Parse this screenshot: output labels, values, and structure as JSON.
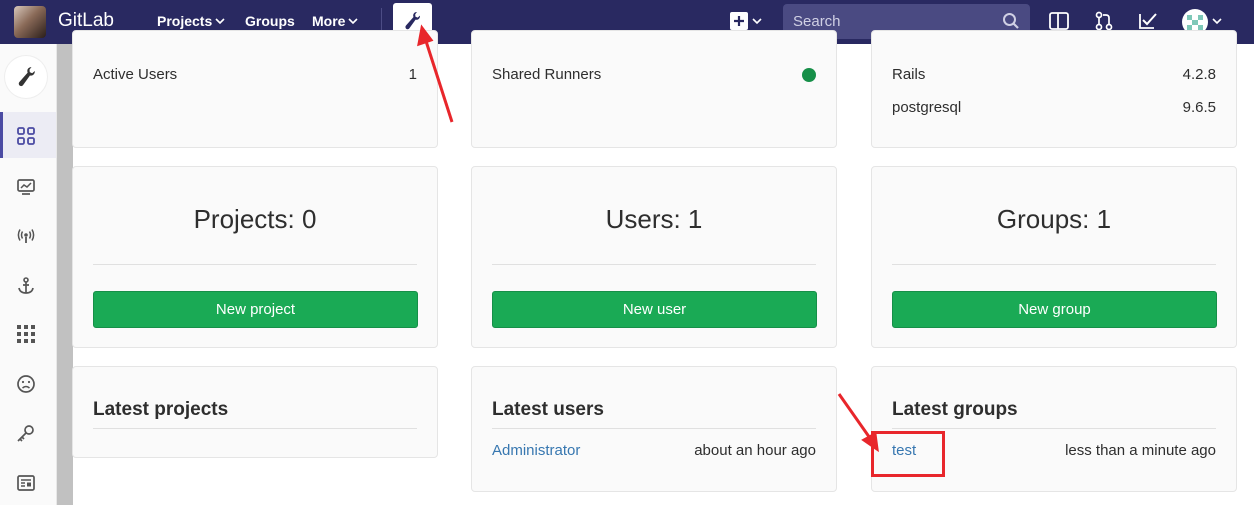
{
  "navbar": {
    "brand": "GitLab",
    "projects_label": "Projects",
    "groups_label": "Groups",
    "more_label": "More",
    "search_placeholder": "Search"
  },
  "sidebar": {
    "items": [
      {
        "icon": "overview-grid-icon"
      },
      {
        "icon": "monitoring-icon"
      },
      {
        "icon": "messages-broadcast-icon"
      },
      {
        "icon": "system-hooks-icon"
      },
      {
        "icon": "applications-icon"
      },
      {
        "icon": "abuse-reports-icon"
      },
      {
        "icon": "deploy-keys-icon"
      },
      {
        "icon": "service-templates-icon"
      }
    ]
  },
  "stats_card": {
    "active_users_label": "Active Users",
    "active_users_value": "1"
  },
  "features_card": {
    "shared_runners_label": "Shared Runners"
  },
  "components_card": {
    "rows": [
      {
        "label": "Rails",
        "value": "4.2.8"
      },
      {
        "label": "postgresql",
        "value": "9.6.5"
      }
    ]
  },
  "counts": {
    "projects": {
      "title": "Projects: 0",
      "button": "New project"
    },
    "users": {
      "title": "Users: 1",
      "button": "New user"
    },
    "groups": {
      "title": "Groups: 1",
      "button": "New group"
    }
  },
  "latest": {
    "projects": {
      "title": "Latest projects"
    },
    "users": {
      "title": "Latest users",
      "item_name": "Administrator",
      "item_time": "about an hour ago"
    },
    "groups": {
      "title": "Latest groups",
      "item_name": "test",
      "item_time": "less than a minute ago"
    }
  },
  "colors": {
    "navbar": "#292961",
    "green_button": "#1aaa55",
    "link": "#3777b0",
    "annotation": "#e8262b"
  }
}
